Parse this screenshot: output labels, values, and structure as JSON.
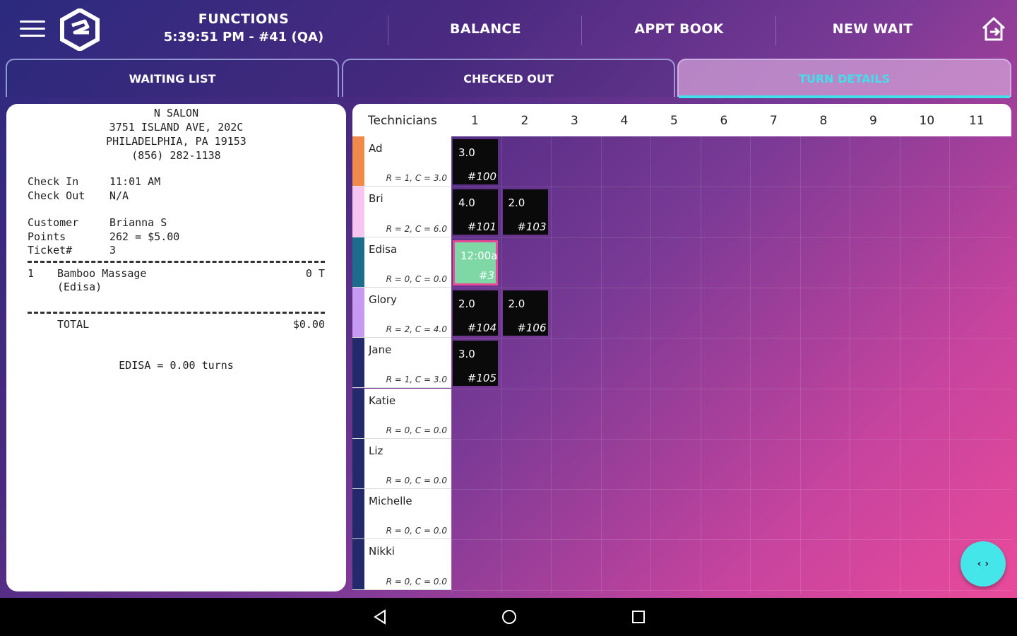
{
  "header": {
    "functions_label": "FUNCTIONS",
    "status_line": "5:39:51 PM - #41 (QA)",
    "nav": [
      "BALANCE",
      "APPT BOOK",
      "NEW WAIT"
    ]
  },
  "tabs": [
    "WAITING LIST",
    "CHECKED OUT",
    "TURN DETAILS"
  ],
  "receipt": {
    "salon": "N SALON",
    "address1": "3751 ISLAND AVE, 202C",
    "address2": "PHILADELPHIA, PA 19153",
    "phone": "(856) 282-1138",
    "check_in_label": "Check In",
    "check_in": "11:01 AM",
    "check_out_label": "Check Out",
    "check_out": "N/A",
    "customer_label": "Customer",
    "customer": "Brianna S",
    "points_label": "Points",
    "points": "262 = $5.00",
    "ticket_label": "Ticket#",
    "ticket": "3",
    "item_qty": "1",
    "item_name": "Bamboo Massage",
    "item_tech": "(Edisa)",
    "item_flag": "0 T",
    "total_label": "TOTAL",
    "total": "$0.00",
    "turns": "EDISA = 0.00 turns"
  },
  "grid": {
    "header_label": "Technicians",
    "columns": [
      "1",
      "2",
      "3",
      "4",
      "5",
      "6",
      "7",
      "8",
      "9",
      "10",
      "11"
    ],
    "technicians": [
      {
        "name": "Ad",
        "stats": "R = 1, C = 3.0",
        "color": "#f08a4b"
      },
      {
        "name": "Bri",
        "stats": "R = 2, C = 6.0",
        "color": "#f7c6f0"
      },
      {
        "name": "Edisa",
        "stats": "R = 0, C = 0.0",
        "color": "#1c6d8c"
      },
      {
        "name": "Glory",
        "stats": "R = 2, C = 4.0",
        "color": "#c69af0"
      },
      {
        "name": "Jane",
        "stats": "R = 1, C = 3.0",
        "color": "#232a6b"
      },
      {
        "name": "Katie",
        "stats": "R = 0, C = 0.0",
        "color": "#232a6b"
      },
      {
        "name": "Liz",
        "stats": "R = 0, C = 0.0",
        "color": "#232a6b"
      },
      {
        "name": "Michelle",
        "stats": "R = 0, C = 0.0",
        "color": "#232a6b"
      },
      {
        "name": "Nikki",
        "stats": "R = 0, C = 0.0",
        "color": "#232a6b"
      }
    ],
    "cells": [
      {
        "row": 0,
        "col": 0,
        "value": "3.0",
        "ticket": "#100",
        "style": "dark"
      },
      {
        "row": 1,
        "col": 0,
        "value": "4.0",
        "ticket": "#101",
        "style": "dark"
      },
      {
        "row": 1,
        "col": 1,
        "value": "2.0",
        "ticket": "#103",
        "style": "dark"
      },
      {
        "row": 2,
        "col": 0,
        "value": "12:00a",
        "ticket": "#3",
        "style": "green"
      },
      {
        "row": 3,
        "col": 0,
        "value": "2.0",
        "ticket": "#104",
        "style": "dark"
      },
      {
        "row": 3,
        "col": 1,
        "value": "2.0",
        "ticket": "#106",
        "style": "dark"
      },
      {
        "row": 4,
        "col": 0,
        "value": "3.0",
        "ticket": "#105",
        "style": "dark"
      }
    ]
  },
  "fab_label": "‹ ›",
  "icons": [
    "menu-icon",
    "app-logo-icon",
    "exit-icon",
    "back-icon",
    "home-icon",
    "recents-icon"
  ]
}
